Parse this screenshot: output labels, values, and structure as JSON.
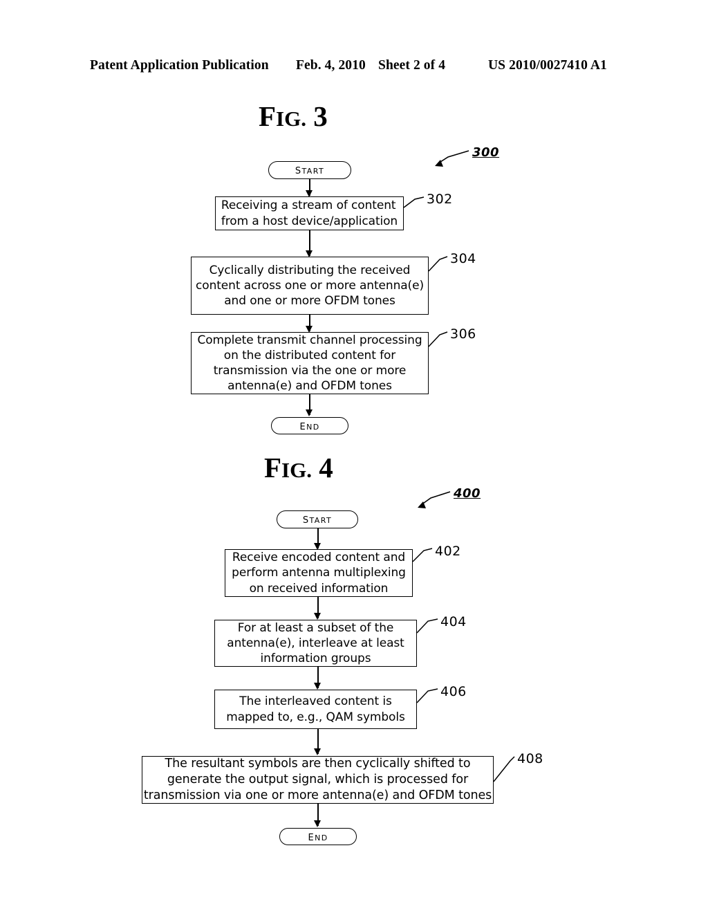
{
  "header": {
    "publication": "Patent Application Publication",
    "date": "Feb. 4, 2010",
    "sheet": "Sheet 2 of 4",
    "patent_number": "US 2010/0027410 A1"
  },
  "figures": [
    {
      "title_prefix": "F",
      "title_small_caps": "IG.",
      "title_number": "3",
      "figure_ref": "300",
      "nodes": [
        {
          "id": "start3",
          "type": "terminator",
          "label": "START"
        },
        {
          "id": "box302",
          "type": "process",
          "ref": "302",
          "text": "Receiving a stream of content\nfrom a host device/application"
        },
        {
          "id": "box304",
          "type": "process",
          "ref": "304",
          "text": "Cyclically distributing the received\ncontent across one or more antenna(e)\nand one or more OFDM tones"
        },
        {
          "id": "box306",
          "type": "process",
          "ref": "306",
          "text": "Complete transmit channel processing\non the distributed content for\ntransmission via the one or more\nantenna(e) and OFDM tones"
        },
        {
          "id": "end3",
          "type": "terminator",
          "label": "END"
        }
      ]
    },
    {
      "title_prefix": "F",
      "title_small_caps": "IG.",
      "title_number": "4",
      "figure_ref": "400",
      "nodes": [
        {
          "id": "start4",
          "type": "terminator",
          "label": "START"
        },
        {
          "id": "box402",
          "type": "process",
          "ref": "402",
          "text": "Receive encoded content and\nperform antenna multiplexing\non received information"
        },
        {
          "id": "box404",
          "type": "process",
          "ref": "404",
          "text": "For at least a subset of the\nantenna(e), interleave at least\ninformation groups"
        },
        {
          "id": "box406",
          "type": "process",
          "ref": "406",
          "text": "The interleaved content is\nmapped to, e.g., QAM symbols"
        },
        {
          "id": "box408",
          "type": "process",
          "ref": "408",
          "text": "The resultant symbols are then cyclically shifted to\ngenerate the output signal, which is processed for\ntransmission via one or more antenna(e) and OFDM tones"
        },
        {
          "id": "end4",
          "type": "terminator",
          "label": "END"
        }
      ]
    }
  ],
  "colors": {
    "ink": "#000000",
    "paper": "#ffffff"
  }
}
